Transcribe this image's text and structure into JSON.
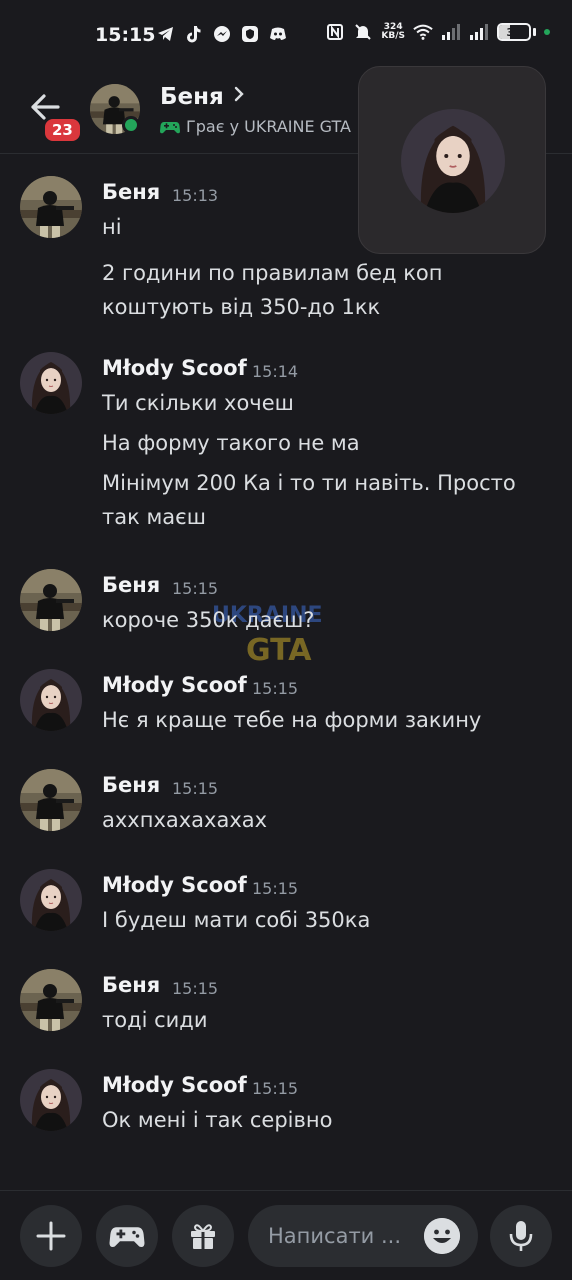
{
  "status_bar": {
    "time": "15:15",
    "net_speed_value": "324",
    "net_speed_unit": "KB/S",
    "battery": "37",
    "battery_level": 0.37
  },
  "header": {
    "unread_count": "23",
    "name": "Беня",
    "activity": "Грає у UKRAINE GTA"
  },
  "watermark": {
    "line1": "UKRAINE",
    "line2": "GTA"
  },
  "messages": [
    {
      "author": "Беня",
      "time": "15:13",
      "avatar": "benya",
      "lines": [
        "ні",
        "2 години по правилам бед коп",
        "коштують від 350-до 1кк"
      ]
    },
    {
      "author": "Młody Scoof",
      "time": "15:14",
      "avatar": "scoof",
      "lines": [
        "Ти скільки хочеш",
        "На форму такого не ма",
        "Мінімум 200 Ка і то ти навіть. Просто",
        "так маєш"
      ]
    },
    {
      "author": "Беня",
      "time": "15:15",
      "avatar": "benya",
      "lines": [
        "короче 350к даєш?"
      ]
    },
    {
      "author": "Młody Scoof",
      "time": "15:15",
      "avatar": "scoof",
      "lines": [
        "Нє я краще тебе на форми закину"
      ]
    },
    {
      "author": "Беня",
      "time": "15:15",
      "avatar": "benya",
      "lines": [
        "аххпхахахахах"
      ]
    },
    {
      "author": "Młody Scoof",
      "time": "15:15",
      "avatar": "scoof",
      "lines": [
        "І будеш мати собі 350ка"
      ]
    },
    {
      "author": "Беня",
      "time": "15:15",
      "avatar": "benya",
      "lines": [
        "тоді сиди"
      ]
    },
    {
      "author": "Młody Scoof",
      "time": "15:15",
      "avatar": "scoof",
      "lines": [
        "Ок мені і так серівно"
      ]
    }
  ],
  "composer": {
    "placeholder": "Написати ..."
  },
  "icons": {
    "back": "arrow-left-icon",
    "gamepad": "gamepad-icon",
    "add": "plus-icon",
    "gift": "gift-icon",
    "emoji": "emoji-icon",
    "mic": "microphone-icon"
  },
  "colors": {
    "background": "#1a1a1e",
    "online": "#23a55a",
    "badge": "#da373c"
  }
}
